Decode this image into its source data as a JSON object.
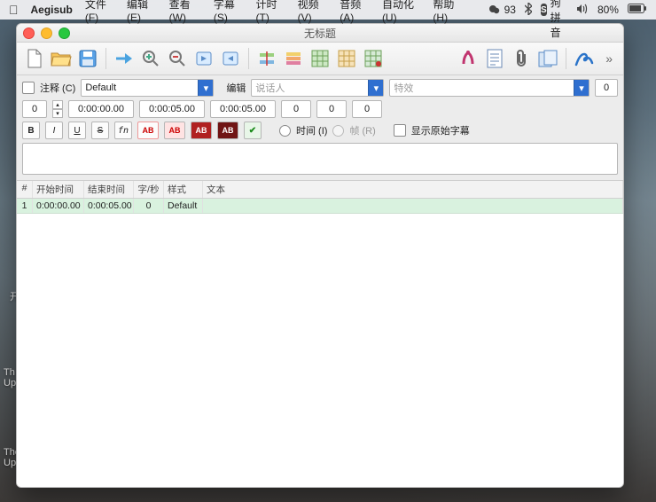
{
  "menubar": {
    "app": "Aegisub",
    "items": [
      "文件 (F)",
      "编辑 (E)",
      "查看 (W)",
      "字幕 (S)",
      "计时 (T)",
      "视频 (V)",
      "音频 (A)",
      "自动化 (U)",
      "帮助 (H)"
    ],
    "wechat_count": "93",
    "ime_label": "搜狗拼音",
    "battery_pct": "80%"
  },
  "window": {
    "title": "无标题",
    "comment_label": "注释 (C)",
    "style": "Default",
    "edit_label": "编辑",
    "actor_placeholder": "说话人",
    "effect_placeholder": "特效",
    "chars_per_sec": "0",
    "layer": "0",
    "start": "0:00:00.00",
    "end": "0:00:05.00",
    "duration": "0:00:05.00",
    "margin_l": "0",
    "margin_r": "0",
    "margin_v": "0",
    "by_time_label": "时间 (I)",
    "by_frame_label": "帧 (R)",
    "show_original_label": "显示原始字幕"
  },
  "grid": {
    "headers": {
      "num": "#",
      "start": "开始时间",
      "end": "结束时间",
      "cps": "字/秒",
      "style": "样式",
      "text": "文本"
    },
    "rows": [
      {
        "num": "1",
        "start": "0:00:00.00",
        "end": "0:00:05.00",
        "cps": "0",
        "style": "Default",
        "text": ""
      }
    ]
  },
  "bg": {
    "a": "开",
    "b": "Th\nUp",
    "c": "The\nUp ("
  }
}
